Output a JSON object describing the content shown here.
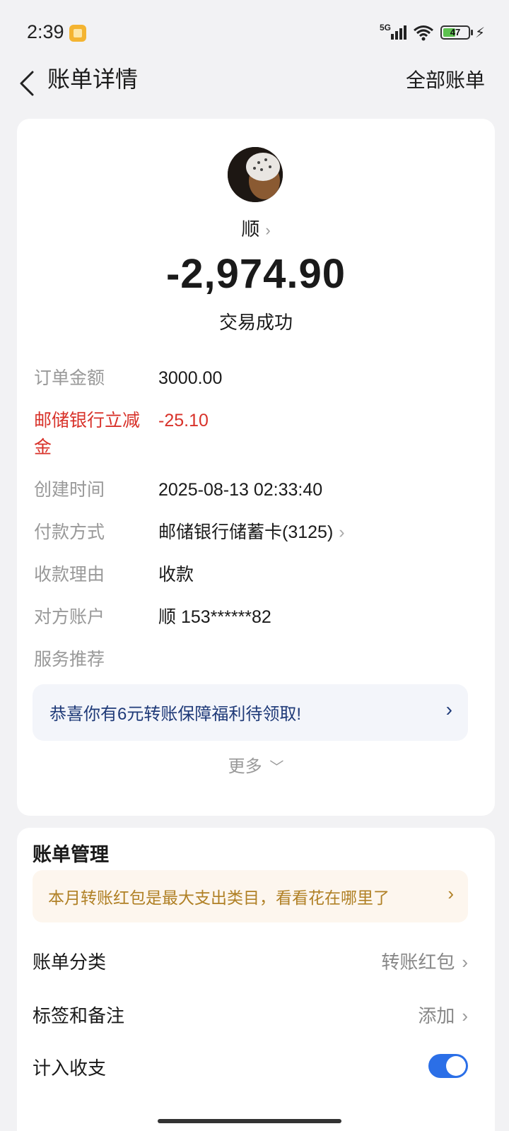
{
  "status_bar": {
    "time": "2:39",
    "network": "5G",
    "battery": "47"
  },
  "nav": {
    "title": "账单详情",
    "right_action": "全部账单"
  },
  "transaction": {
    "payee": "顺",
    "amount": "-2,974.90",
    "status": "交易成功"
  },
  "details": [
    {
      "label": "订单金额",
      "value": "3000.00"
    },
    {
      "label": "邮储银行立减金",
      "value": "-25.10"
    },
    {
      "label": "创建时间",
      "value": "2025-08-13 02:33:40"
    },
    {
      "label": "付款方式",
      "value": "邮储银行储蓄卡(3125)"
    },
    {
      "label": "收款理由",
      "value": "收款"
    },
    {
      "label": "对方账户",
      "value": "顺 153******82"
    },
    {
      "label": "服务推荐",
      "value": ""
    }
  ],
  "promo": {
    "text": "恭喜你有6元转账保障福利待领取!"
  },
  "more_label": "更多",
  "management": {
    "title": "账单管理",
    "insight": "本月转账红包是最大支出类目，看看花在哪里了",
    "rows": [
      {
        "label": "账单分类",
        "value": "转账红包"
      },
      {
        "label": "标签和备注",
        "value": "添加"
      },
      {
        "label": "计入收支",
        "value": ""
      }
    ],
    "include_in_budget": true
  },
  "colors": {
    "accent": "#2b6fe7",
    "discount_red": "#d8322a",
    "promo_text": "#1f3a78",
    "insight_text": "#b08025"
  }
}
